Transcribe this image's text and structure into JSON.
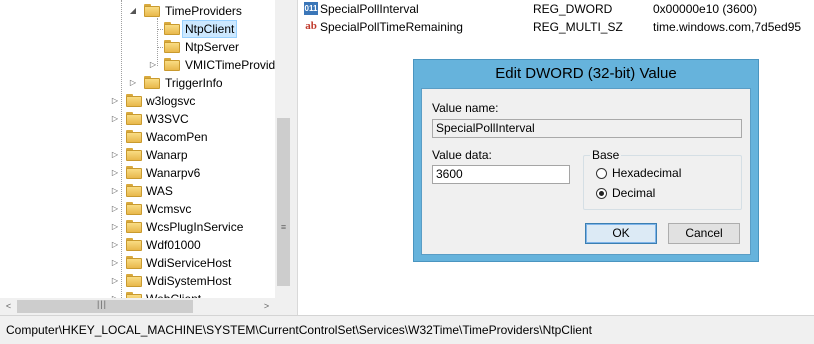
{
  "tree": {
    "items": [
      {
        "label": "TimeProviders",
        "expander": "◢"
      },
      {
        "label": "NtpClient",
        "expander": ""
      },
      {
        "label": "NtpServer",
        "expander": ""
      },
      {
        "label": "VMICTimeProvid",
        "expander": "▷"
      },
      {
        "label": "TriggerInfo",
        "expander": "▷"
      },
      {
        "label": "w3logsvc",
        "expander": "▷"
      },
      {
        "label": "W3SVC",
        "expander": "▷"
      },
      {
        "label": "WacomPen",
        "expander": ""
      },
      {
        "label": "Wanarp",
        "expander": "▷"
      },
      {
        "label": "Wanarpv6",
        "expander": "▷"
      },
      {
        "label": "WAS",
        "expander": "▷"
      },
      {
        "label": "Wcmsvc",
        "expander": "▷"
      },
      {
        "label": "WcsPlugInService",
        "expander": "▷"
      },
      {
        "label": "Wdf01000",
        "expander": "▷"
      },
      {
        "label": "WdiServiceHost",
        "expander": "▷"
      },
      {
        "label": "WdiSystemHost",
        "expander": "▷"
      },
      {
        "label": "WebClient",
        "expander": "▷"
      }
    ],
    "hscroll": {
      "left_arrow": "<",
      "right_arrow": ">",
      "grip": "|||"
    },
    "vscroll": {
      "grip": "≡"
    }
  },
  "values": [
    {
      "icon": "binary-value-icon",
      "icon_text": "011",
      "name": "SpecialPollInterval",
      "type": "REG_DWORD",
      "data": "0x00000e10 (3600)"
    },
    {
      "icon": "string-value-icon",
      "icon_text": "ab",
      "name": "SpecialPollTimeRemaining",
      "type": "REG_MULTI_SZ",
      "data": "time.windows.com,7d5ed95"
    }
  ],
  "status": {
    "path": "Computer\\HKEY_LOCAL_MACHINE\\SYSTEM\\CurrentControlSet\\Services\\W32Time\\TimeProviders\\NtpClient"
  },
  "dialog": {
    "title": "Edit DWORD (32-bit) Value",
    "value_name_label": "Value name:",
    "value_name": "SpecialPollInterval",
    "value_data_label": "Value data:",
    "value_data": "3600",
    "base_label": "Base",
    "hex_label": "Hexadecimal",
    "dec_label": "Decimal",
    "selected_base": "Decimal",
    "ok_label": "OK",
    "cancel_label": "Cancel",
    "colors": {
      "frame": "#66b3dc",
      "client": "#f0f0f0"
    }
  }
}
